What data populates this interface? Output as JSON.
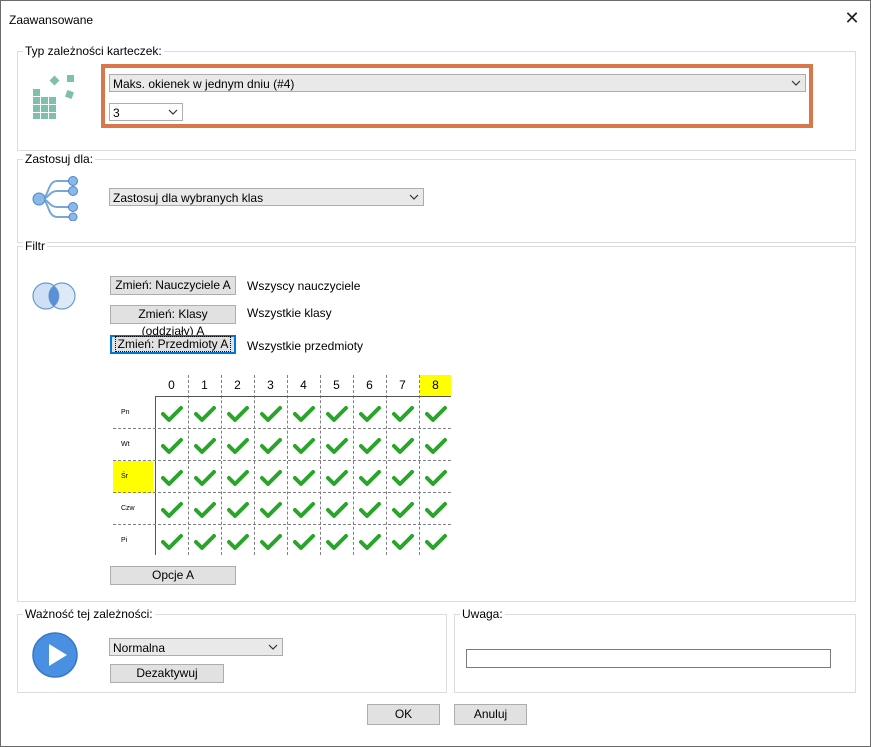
{
  "window": {
    "title": "Zaawansowane"
  },
  "type_group": {
    "label": "Typ zależności karteczek:",
    "combo_value": "Maks. okienek w jednym dniu (#4)",
    "number_value": "3"
  },
  "apply_group": {
    "label": "Zastosuj dla:",
    "combo_value": "Zastosuj dla wybranych klas"
  },
  "filter_group": {
    "label": "Filtr",
    "buttons": [
      {
        "label": "Zmień: Nauczyciele A",
        "status": "Wszyscy nauczyciele"
      },
      {
        "label": "Zmień: Klasy (oddziały) A",
        "status": "Wszystkie klasy"
      },
      {
        "label": "Zmień: Przedmioty A",
        "status": "Wszystkie przedmioty"
      }
    ],
    "columns": [
      "0",
      "1",
      "2",
      "3",
      "4",
      "5",
      "6",
      "7",
      "8"
    ],
    "highlighted_column": "8",
    "rows": [
      "Pn",
      "Wt",
      "Śr",
      "Czw",
      "Pi"
    ],
    "highlighted_row": "Śr",
    "options_button": "Opcje A"
  },
  "importance_group": {
    "label": "Ważność tej zależności:",
    "combo_value": "Normalna",
    "deactivate_button": "Dezaktywuj"
  },
  "note_group": {
    "label": "Uwaga:",
    "value": ""
  },
  "footer": {
    "ok_button": "OK",
    "cancel_button": "Anuluj"
  },
  "colors": {
    "highlight_border": "#d9764a",
    "check_green": "#2aa42a",
    "highlight_yellow": "#ffff00",
    "accent_blue": "#4a90e2"
  }
}
